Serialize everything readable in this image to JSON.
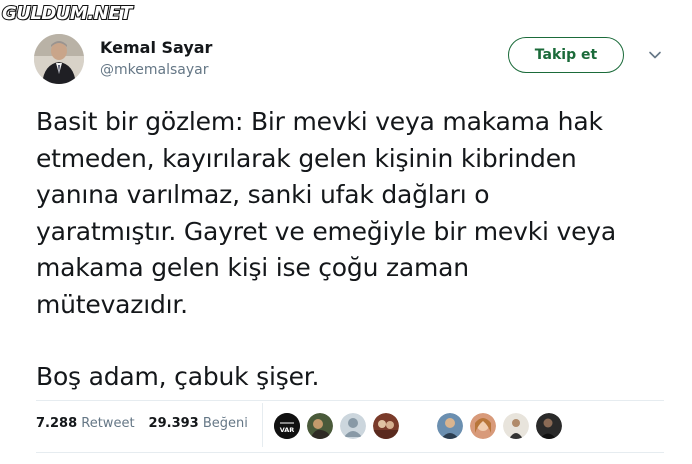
{
  "watermark": "GULDUM.NET",
  "author": {
    "name": "Kemal Sayar",
    "handle": "@mkemalsayar"
  },
  "follow_label": "Takip et",
  "tweet": {
    "lines": [
      "Basit bir gözlem: Bir mevki veya makama hak",
      "etmeden, kayırılarak gelen kişinin kibrinden",
      "yanına varılmaz, sanki ufak dağları o",
      "yaratmıştır. Gayret ve emeğiyle bir mevki veya",
      "makama gelen kişi ise çoğu zaman",
      "mütevazıdır."
    ],
    "closing": "Boş adam, çabuk şişer."
  },
  "stats": {
    "retweets_count": "7.288",
    "retweets_label": "Retweet",
    "likes_count": "29.393",
    "likes_label": "Beğeni"
  },
  "liker_badge_text": "VAR",
  "colors": {
    "follow_accent": "#1b6b3a",
    "text_primary": "#14171a",
    "text_secondary": "#657786",
    "divider": "#e6ecf0"
  }
}
